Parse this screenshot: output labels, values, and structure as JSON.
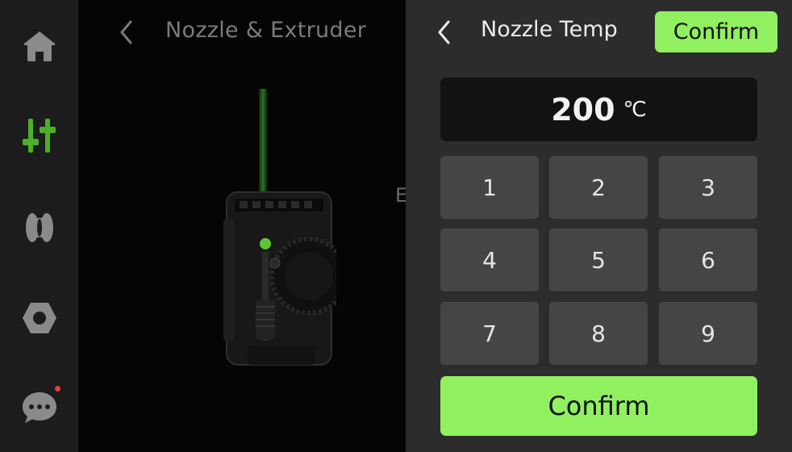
{
  "colors": {
    "accent": "#90f060",
    "nav_active": "#4caf28",
    "notification": "#e0453a"
  },
  "nav": {
    "items": [
      {
        "icon": "home-icon",
        "active": false
      },
      {
        "icon": "sliders-icon",
        "active": true
      },
      {
        "icon": "filament-spool-icon",
        "active": false
      },
      {
        "icon": "hex-nut-icon",
        "active": false
      },
      {
        "icon": "chat-icon",
        "active": false,
        "notification": true
      }
    ]
  },
  "main": {
    "title": "Nozzle & Extruder",
    "peek_text": "E"
  },
  "dialog": {
    "title": "Nozzle Temp",
    "confirm_top": "Confirm",
    "value": "200",
    "unit": "℃",
    "keys": [
      "1",
      "2",
      "3",
      "4",
      "5",
      "6",
      "7",
      "8",
      "9"
    ],
    "confirm_bottom": "Confirm"
  }
}
